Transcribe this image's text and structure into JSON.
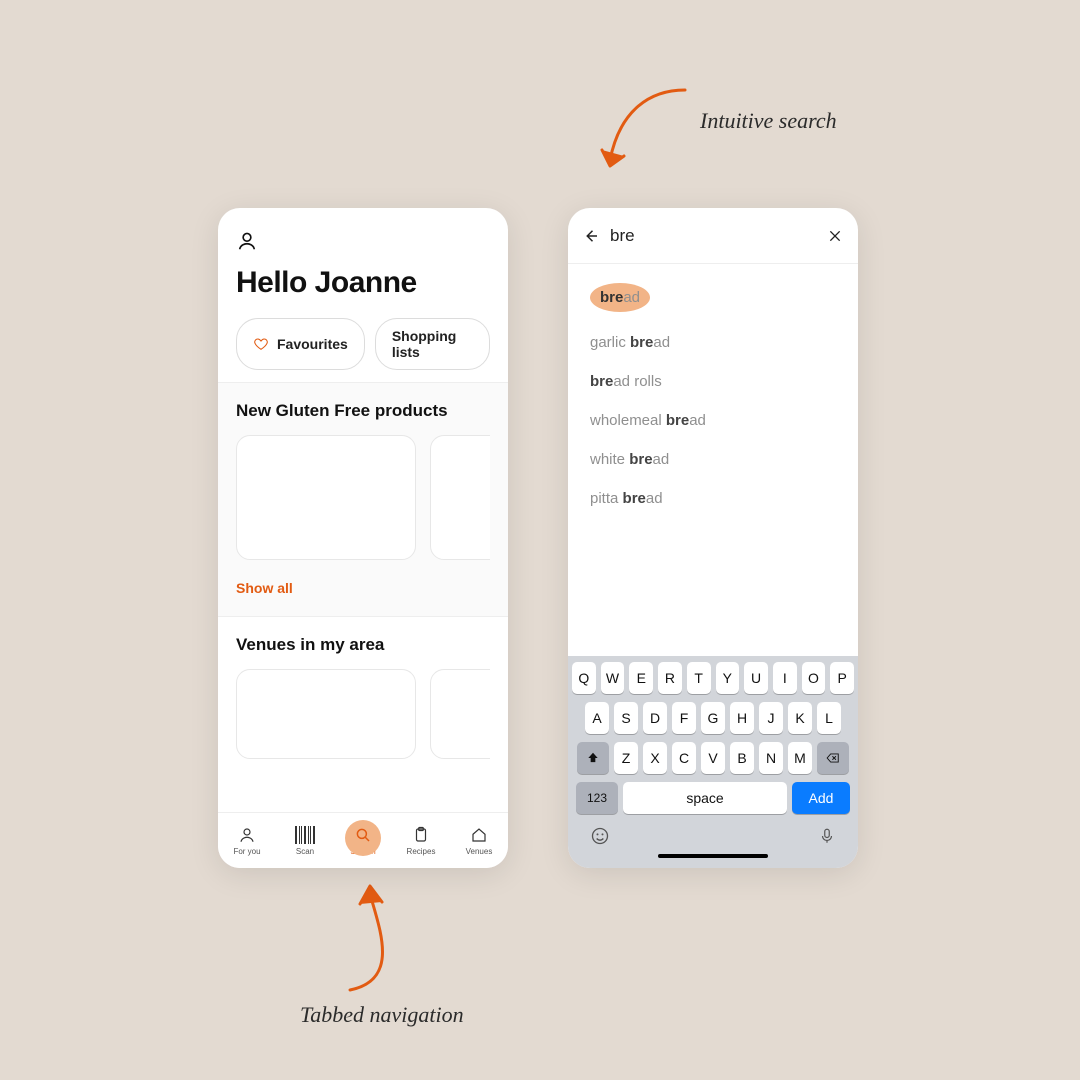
{
  "annotations": {
    "top": "Intuitive search",
    "bottom": "Tabbed navigation"
  },
  "colors": {
    "accent": "#e25b12",
    "accent_light": "#f2b487"
  },
  "home": {
    "greeting": "Hello Joanne",
    "pills": {
      "favourites": "Favourites",
      "shopping_lists": "Shopping lists"
    },
    "section1_title": "New Gluten Free products",
    "show_all": "Show all",
    "section2_title": "Venues in my area",
    "tabs": [
      {
        "label": "For you"
      },
      {
        "label": "Scan"
      },
      {
        "label": "Search"
      },
      {
        "label": "Recipes"
      },
      {
        "label": "Venues"
      }
    ],
    "active_tab_index": 2
  },
  "search": {
    "query": "bre",
    "results": [
      {
        "pre": "",
        "match": "bre",
        "post": "ad",
        "highlight": true
      },
      {
        "pre": "garlic ",
        "match": "bre",
        "post": "ad",
        "highlight": false
      },
      {
        "pre": "",
        "match": "bre",
        "post": "ad rolls",
        "highlight": false
      },
      {
        "pre": "wholemeal ",
        "match": "bre",
        "post": "ad",
        "highlight": false
      },
      {
        "pre": "white ",
        "match": "bre",
        "post": "ad",
        "highlight": false
      },
      {
        "pre": "pitta ",
        "match": "bre",
        "post": "ad",
        "highlight": false
      }
    ],
    "keyboard": {
      "row1": [
        "Q",
        "W",
        "E",
        "R",
        "T",
        "Y",
        "U",
        "I",
        "O",
        "P"
      ],
      "row2": [
        "A",
        "S",
        "D",
        "F",
        "G",
        "H",
        "J",
        "K",
        "L"
      ],
      "row3": [
        "Z",
        "X",
        "C",
        "V",
        "B",
        "N",
        "M"
      ],
      "num_key": "123",
      "space_key": "space",
      "action_key": "Add"
    }
  }
}
